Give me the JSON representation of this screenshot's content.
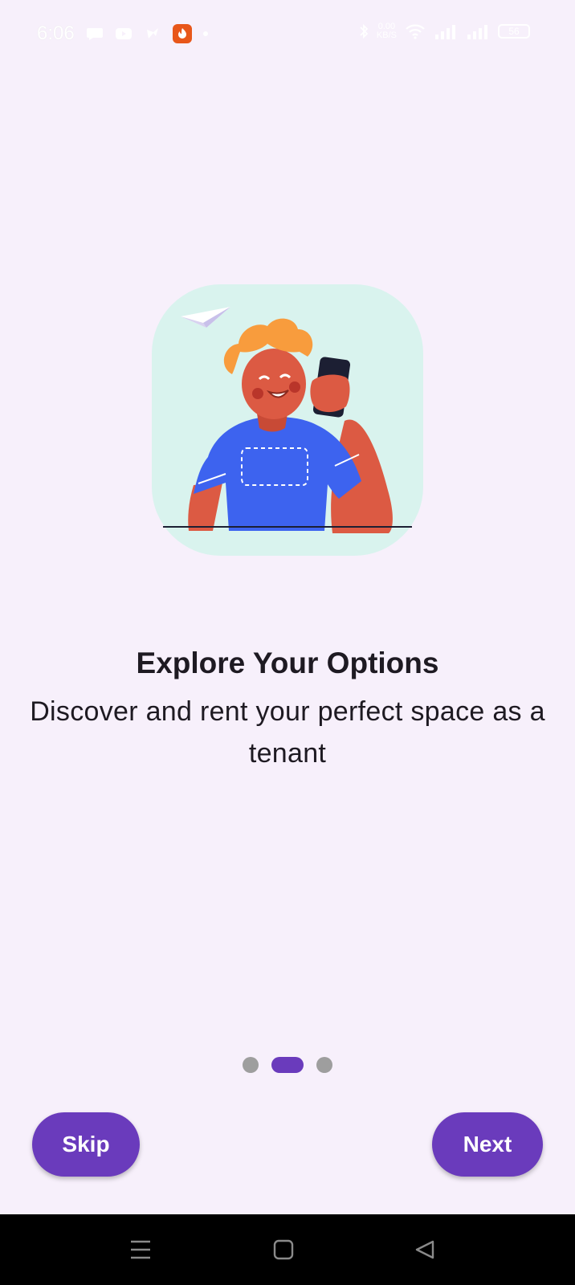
{
  "status_bar": {
    "time": "6:06",
    "network_speed_top": "0.00",
    "network_speed_bottom": "KB/S",
    "battery": "56"
  },
  "onboarding": {
    "title": "Explore Your Options",
    "subtitle": "Discover and rent your perfect space as a tenant",
    "page_count": 3,
    "current_page": 2
  },
  "actions": {
    "skip_label": "Skip",
    "next_label": "Next"
  },
  "colors": {
    "background": "#f7f0fb",
    "accent": "#6a3bbc",
    "illustration_bg": "#d9f3ee"
  }
}
